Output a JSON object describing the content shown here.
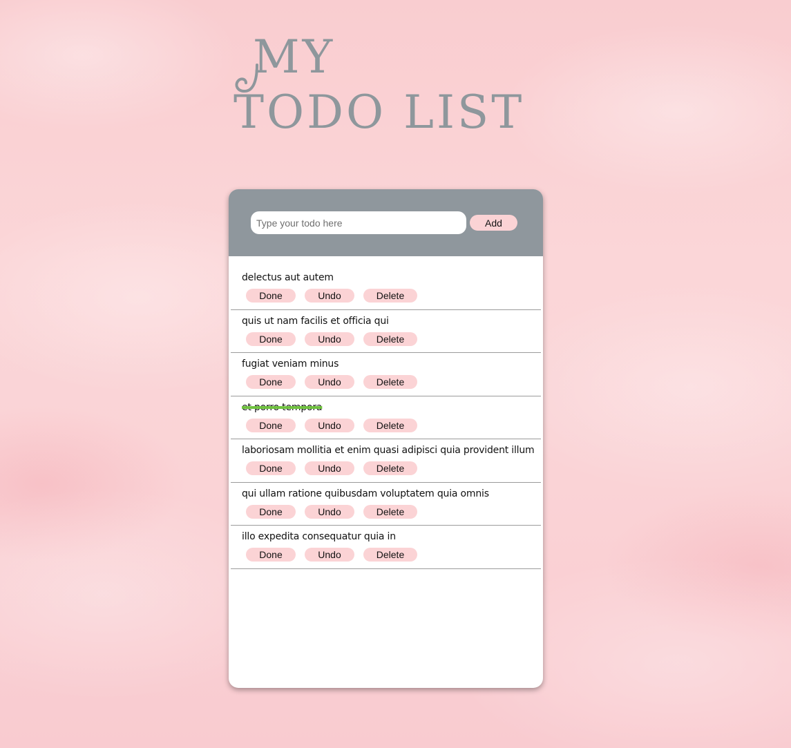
{
  "title": {
    "line1": "MY",
    "line2": "TODO LIST"
  },
  "form": {
    "input_placeholder": "Type your todo here",
    "input_value": "",
    "add_label": "Add"
  },
  "buttons": {
    "done_label": "Done",
    "undo_label": "Undo",
    "delete_label": "Delete"
  },
  "todos": [
    {
      "text": "delectus aut autem",
      "completed": false
    },
    {
      "text": "quis ut nam facilis et officia qui",
      "completed": false
    },
    {
      "text": "fugiat veniam minus",
      "completed": false
    },
    {
      "text": "et porro tempora",
      "completed": true
    },
    {
      "text": "laboriosam mollitia et enim quasi adipisci quia provident illum",
      "completed": false
    },
    {
      "text": "qui ullam ratione quibusdam voluptatem quia omnis",
      "completed": false
    },
    {
      "text": "illo expedita consequatur quia in",
      "completed": false
    }
  ],
  "colors": {
    "header": "#8f979d",
    "button": "#fbd3d5",
    "title": "#8e979c",
    "strike": "#6fc13f"
  }
}
